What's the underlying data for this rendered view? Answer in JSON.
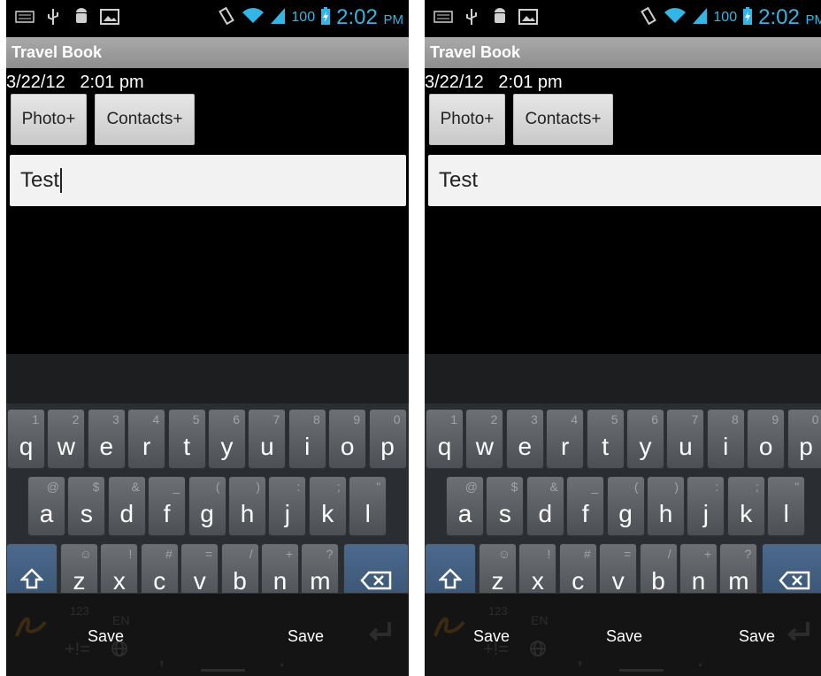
{
  "status_bar": {
    "battery_percent": "100",
    "time": "2:02",
    "time_suffix": "PM",
    "icon_names": [
      "keyboard-icon",
      "usb-icon",
      "android-debug-icon",
      "image-icon",
      "vibrate-icon",
      "wifi-icon",
      "signal-icon",
      "battery-charging-icon"
    ],
    "accent_color": "#33b5e5"
  },
  "app": {
    "title": "Travel Book"
  },
  "entry": {
    "date": "3/22/12",
    "time": "2:01 pm"
  },
  "buttons": {
    "photo": "Photo+",
    "contacts": "Contacts+"
  },
  "text_field": {
    "value": "Test"
  },
  "keyboard": {
    "row1": [
      {
        "main": "q",
        "alt": "1"
      },
      {
        "main": "w",
        "alt": "2"
      },
      {
        "main": "e",
        "alt": "3"
      },
      {
        "main": "r",
        "alt": "4"
      },
      {
        "main": "t",
        "alt": "5"
      },
      {
        "main": "y",
        "alt": "6"
      },
      {
        "main": "u",
        "alt": "7"
      },
      {
        "main": "i",
        "alt": "8"
      },
      {
        "main": "o",
        "alt": "9"
      },
      {
        "main": "p",
        "alt": "0"
      }
    ],
    "row2": [
      {
        "main": "a",
        "alt": "@"
      },
      {
        "main": "s",
        "alt": "$"
      },
      {
        "main": "d",
        "alt": "&"
      },
      {
        "main": "f",
        "alt": "_"
      },
      {
        "main": "g",
        "alt": "("
      },
      {
        "main": "h",
        "alt": ")"
      },
      {
        "main": "j",
        "alt": ":"
      },
      {
        "main": "k",
        "alt": ";"
      },
      {
        "main": "l",
        "alt": "\""
      }
    ],
    "row3": [
      {
        "main": "z",
        "alt": "☺"
      },
      {
        "main": "x",
        "alt": "!"
      },
      {
        "main": "c",
        "alt": "#"
      },
      {
        "main": "v",
        "alt": "="
      },
      {
        "main": "b",
        "alt": "/"
      },
      {
        "main": "n",
        "alt": "+"
      },
      {
        "main": "m",
        "alt": "?"
      }
    ],
    "shift_icon": "shift-icon",
    "backspace_icon": "backspace-icon"
  },
  "bottom_left": {
    "save_labels": [
      "Save",
      "Save"
    ]
  },
  "bottom_right": {
    "save_labels": [
      "Save",
      "Save",
      "Save"
    ]
  },
  "bottom_ghost": {
    "sym": "123",
    "sym2": "+!=",
    "lang": "EN"
  }
}
